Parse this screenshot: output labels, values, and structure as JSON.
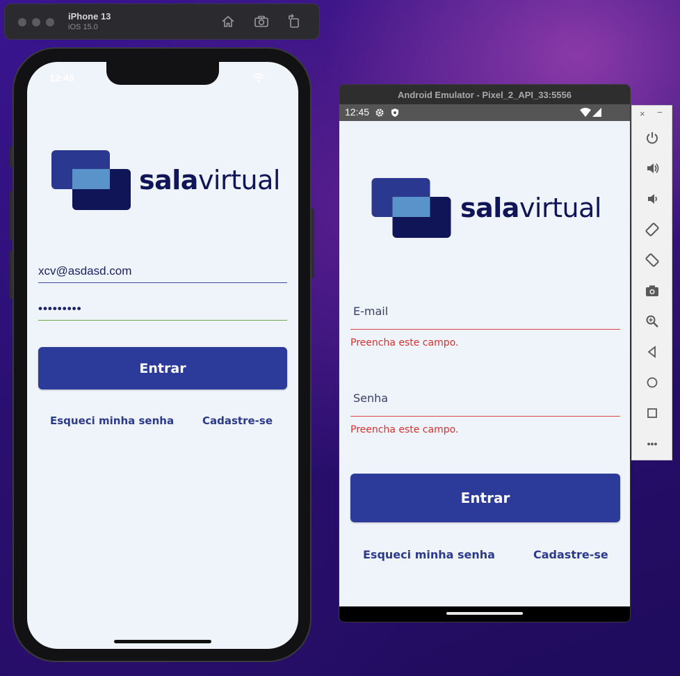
{
  "simulator": {
    "device_name": "iPhone 13",
    "os_version": "iOS 15.0",
    "toolbar_icons": [
      "home-icon",
      "screenshot-icon",
      "rotate-icon"
    ]
  },
  "ios_app": {
    "status_time": "12:45",
    "logo": {
      "bold": "sala",
      "light": "virtual"
    },
    "email_value": "xcv@asdasd.com",
    "password_value": "•••••••••",
    "login_button": "Entrar",
    "forgot_link": "Esqueci minha senha",
    "signup_link": "Cadastre-se"
  },
  "android_emulator": {
    "window_title": "Android Emulator - Pixel_2_API_33:5556",
    "status_time": "12:45",
    "logo": {
      "bold": "sala",
      "light": "virtual"
    },
    "email_label": "E-mail",
    "email_error": "Preencha este campo.",
    "password_label": "Senha",
    "password_error": "Preencha este campo.",
    "login_button": "Entrar",
    "forgot_link": "Esqueci minha senha",
    "signup_link": "Cadastre-se"
  },
  "emulator_panel": {
    "close": "×",
    "minimize": "−",
    "icons": [
      "power-icon",
      "volume-up-icon",
      "volume-down-icon",
      "rotate-left-icon",
      "rotate-right-icon",
      "camera-icon",
      "zoom-icon",
      "back-icon",
      "home-icon",
      "overview-icon",
      "more-icon"
    ],
    "more_label": "•••"
  },
  "colors": {
    "brand_dark": "#0f1557",
    "button": "#2c3a99",
    "logo_mid": "#2b3890",
    "logo_light": "#5a93c9",
    "error": "#d9302c",
    "screen_bg": "#eff3fa"
  }
}
